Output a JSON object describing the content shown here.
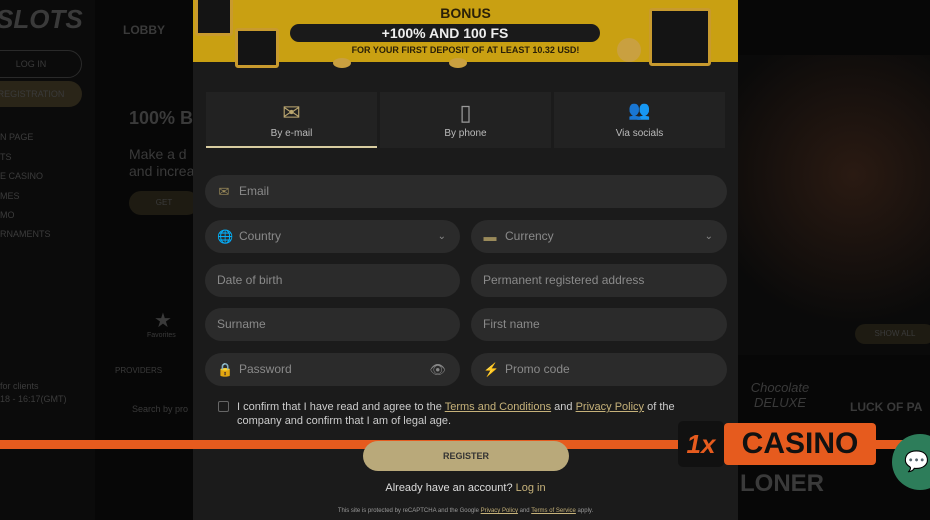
{
  "background": {
    "logo": "SLOTS",
    "lobby": "LOBBY",
    "login": "LOG IN",
    "registration": "REGISTRATION",
    "nav": [
      "N PAGE",
      "TS",
      "E CASINO",
      "MES",
      "MO",
      "RNAMENTS"
    ],
    "promo_title": "100% B",
    "promo_text1": "Make a d",
    "promo_text2": "and increa",
    "promo_button": "GET",
    "favorites": "Favorites",
    "providers": "PROVIDERS",
    "search_placeholder": "Search by pro",
    "support1": "for clients",
    "support2": "18 - 16:17(GMT)",
    "show_all": "SHOW ALL",
    "game1": "Chocolate DELUXE",
    "game2": "LUCK OF PA",
    "game3": "LONER"
  },
  "banner": {
    "title": "BONUS",
    "offer": "+100% AND 100 FS",
    "subtitle": "FOR YOUR FIRST DEPOSIT OF AT LEAST 10.32 USD!"
  },
  "tabs": [
    {
      "label": "By e-mail",
      "icon": "envelope-icon",
      "active": true
    },
    {
      "label": "By phone",
      "icon": "phone-icon"
    },
    {
      "label": "Via socials",
      "icon": "users-icon"
    }
  ],
  "form": {
    "email": "Email",
    "country": "Country",
    "currency": "Currency",
    "dob": "Date of birth",
    "address": "Permanent registered address",
    "surname": "Surname",
    "first_name": "First name",
    "password": "Password",
    "promo": "Promo code"
  },
  "consent": {
    "t1": "I confirm that I have read and agree to the ",
    "terms": "Terms and Conditions",
    "t2": " and ",
    "privacy": "Privacy Policy",
    "t3": " of the company and confirm that I am of legal age.",
    "checked": false
  },
  "register": "REGISTER",
  "login_prompt": "Already have an account?",
  "login_link": "Log in",
  "recaptcha": {
    "t1": "This site is protected by reCAPTCHA and the Google ",
    "privacy": "Privacy Policy",
    "t2": " and ",
    "terms": "Terms of Service",
    "t3": " apply."
  },
  "watermark": {
    "mark": "1x",
    "text": "CASINO"
  },
  "colors": {
    "accent": "#c9a012",
    "orange": "#e65b1e",
    "button": "#b9a97a"
  }
}
